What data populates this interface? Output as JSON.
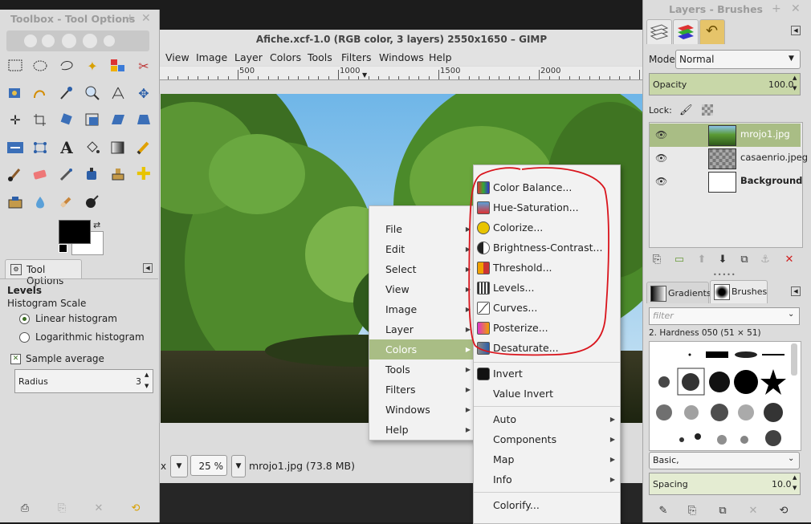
{
  "toolbox": {
    "title": "Toolbox - Tool Options",
    "tool_options_tab": "Tool Options",
    "tool_name": "Levels",
    "histogram_scale_label": "Histogram Scale",
    "linear_label": "Linear histogram",
    "log_label": "Logarithmic histogram",
    "sample_average_label": "Sample average",
    "radius_label": "Radius",
    "radius_value": "3"
  },
  "image_window": {
    "title": "Afiche.xcf-1.0 (RGB color, 3 layers) 2550x1650 – GIMP",
    "menus": [
      "View",
      "Image",
      "Layer",
      "Colors",
      "Tools",
      "Filters",
      "Windows",
      "Help"
    ],
    "ruler_labels": [
      "500",
      "1000",
      "1500",
      "2000"
    ],
    "unit": "x",
    "zoom": "25 %",
    "status": "mrojo1.jpg (73.8 MB)"
  },
  "context_menu": {
    "items": [
      "File",
      "Edit",
      "Select",
      "View",
      "Image",
      "Layer",
      "Colors",
      "Tools",
      "Filters",
      "Windows",
      "Help"
    ],
    "active": "Colors"
  },
  "colors_submenu": {
    "circled_items": [
      "Color Balance...",
      "Hue-Saturation...",
      "Colorize...",
      "Brightness-Contrast...",
      "Threshold...",
      "Levels...",
      "Curves...",
      "Posterize...",
      "Desaturate..."
    ],
    "invert_items": [
      "Invert",
      "Value Invert"
    ],
    "sub_items": [
      "Auto",
      "Components",
      "Map",
      "Info"
    ],
    "extra_items": [
      "Colorify..."
    ]
  },
  "layers_panel": {
    "title": "Layers - Brushes",
    "mode_label": "Mode:",
    "mode_value": "Normal",
    "opacity_label": "Opacity",
    "opacity_value": "100.0",
    "lock_label": "Lock:",
    "layers": [
      "mrojo1.jpg",
      "casaenrio.jpeg",
      "Background"
    ],
    "tabs": [
      "Gradients",
      "Brushes"
    ],
    "filter_placeholder": "filter",
    "brush_name": "2. Hardness 050 (51 × 51)",
    "brush_set": "Basic,",
    "spacing_label": "Spacing",
    "spacing_value": "10.0"
  },
  "colors": {
    "selection": "#a9bd85",
    "annotation": "#d9141c",
    "menu_bg": "#f2f2f2"
  }
}
